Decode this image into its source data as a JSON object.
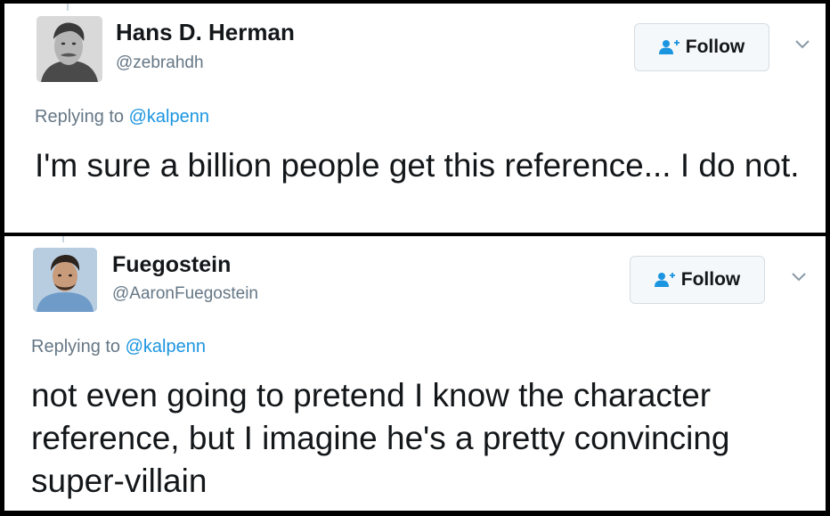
{
  "tweets": [
    {
      "display_name": "Hans D. Herman",
      "handle": "@zebrahdh",
      "follow_label": "Follow",
      "replying_prefix": "Replying to",
      "replying_handle": "@kalpenn",
      "text": "I'm sure a billion people get this reference... I do not."
    },
    {
      "display_name": "Fuegostein",
      "handle": "@AaronFuegostein",
      "follow_label": "Follow",
      "replying_prefix": "Replying to",
      "replying_handle": "@kalpenn",
      "text": "not even going to pretend I know the character reference, but I imagine he's a pretty convincing super-villain"
    }
  ],
  "icons": {
    "follow": "add-person-icon",
    "more": "chevron-down-icon"
  },
  "colors": {
    "link": "#1b95e0",
    "secondary_text": "#657786",
    "primary_text": "#14171a",
    "button_bg": "#f5f8fa"
  }
}
